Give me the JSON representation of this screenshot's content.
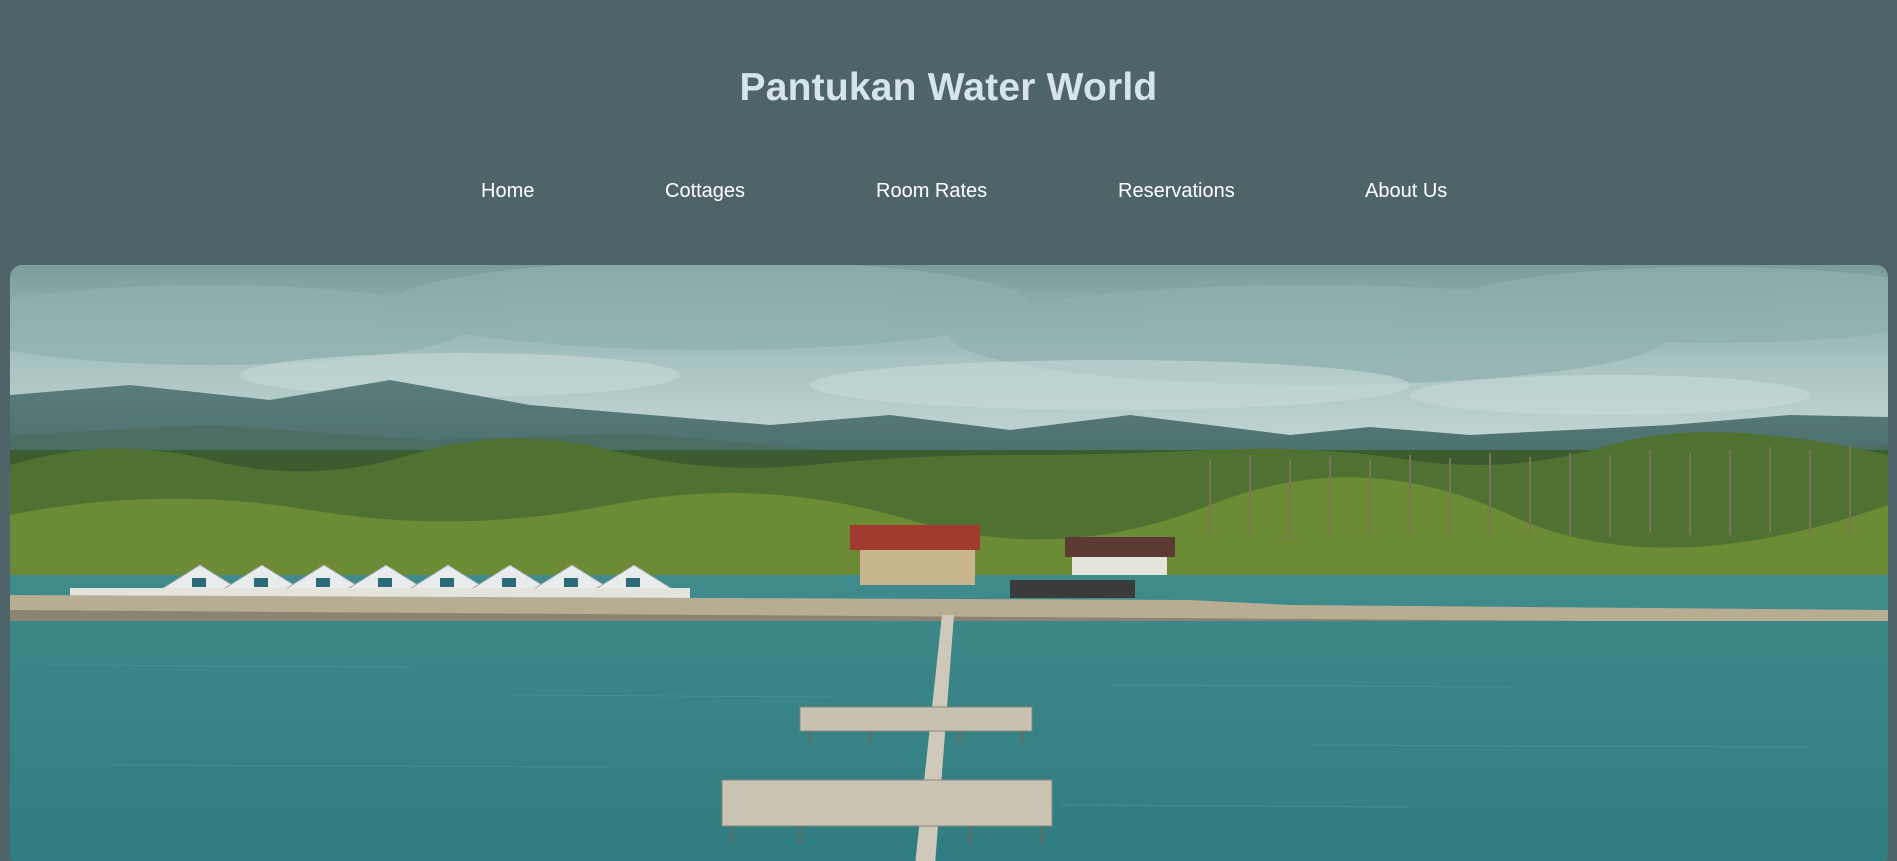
{
  "site": {
    "title": "Pantukan Water World"
  },
  "nav": {
    "items": [
      {
        "label": "Home"
      },
      {
        "label": "Cottages"
      },
      {
        "label": "Room Rates"
      },
      {
        "label": "Reservations"
      },
      {
        "label": "About Us"
      }
    ]
  },
  "colors": {
    "header_bg": "#4e6469",
    "title_text": "#d7e4ec",
    "nav_text": "#ffffff"
  }
}
